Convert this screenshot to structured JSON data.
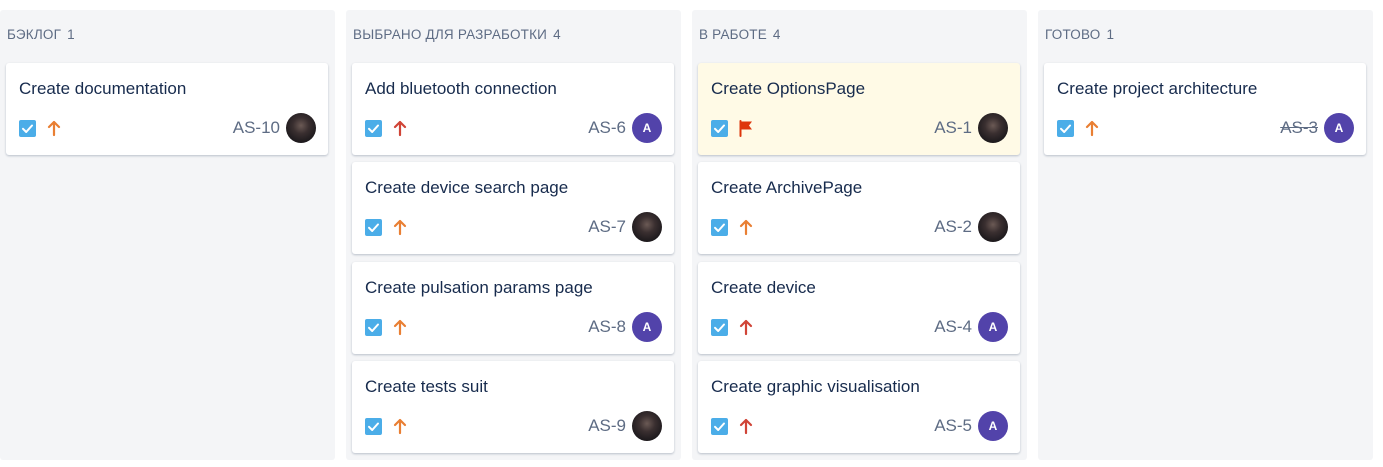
{
  "colors": {
    "column_bg": "#f4f5f7",
    "card_bg": "#ffffff",
    "flagged_bg": "#fffae6",
    "checkbox_blue": "#4bade8",
    "priority_high": "#e97f33",
    "priority_highest": "#d04437",
    "flag_red": "#de350b",
    "avatar_purple": "#5243aa",
    "text_primary": "#172b4d",
    "text_secondary": "#5e6c84"
  },
  "columns": [
    {
      "title": "БЭКЛОГ",
      "count": "1",
      "cards": [
        {
          "title": "Create documentation",
          "key": "AS-10",
          "type_icon": "checkbox-icon",
          "priority_icon": "arrow-up-icon",
          "avatar": "photo",
          "done": false,
          "flagged": false
        }
      ]
    },
    {
      "title": "ВЫБРАНО ДЛЯ РАЗРАБОТКИ",
      "count": "4",
      "cards": [
        {
          "title": "Add bluetooth connection",
          "key": "AS-6",
          "type_icon": "checkbox-icon",
          "priority_icon": "arrow-up-red-icon",
          "avatar": "A",
          "done": false,
          "flagged": false
        },
        {
          "title": "Create device search page",
          "key": "AS-7",
          "type_icon": "checkbox-icon",
          "priority_icon": "arrow-up-icon",
          "avatar": "photo",
          "done": false,
          "flagged": false
        },
        {
          "title": "Create pulsation params page",
          "key": "AS-8",
          "type_icon": "checkbox-icon",
          "priority_icon": "arrow-up-icon",
          "avatar": "A",
          "done": false,
          "flagged": false
        },
        {
          "title": "Create tests suit",
          "key": "AS-9",
          "type_icon": "checkbox-icon",
          "priority_icon": "arrow-up-icon",
          "avatar": "photo",
          "done": false,
          "flagged": false
        }
      ]
    },
    {
      "title": "В РАБОТЕ",
      "count": "4",
      "cards": [
        {
          "title": "Create OptionsPage",
          "key": "AS-1",
          "type_icon": "checkbox-icon",
          "priority_icon": "flag-icon",
          "avatar": "photo",
          "done": false,
          "flagged": true
        },
        {
          "title": "Create ArchivePage",
          "key": "AS-2",
          "type_icon": "checkbox-icon",
          "priority_icon": "arrow-up-icon",
          "avatar": "photo",
          "done": false,
          "flagged": false
        },
        {
          "title": "Create device",
          "key": "AS-4",
          "type_icon": "checkbox-icon",
          "priority_icon": "arrow-up-red-icon",
          "avatar": "A",
          "done": false,
          "flagged": false
        },
        {
          "title": "Create graphic visualisation",
          "key": "AS-5",
          "type_icon": "checkbox-icon",
          "priority_icon": "arrow-up-red-icon",
          "avatar": "A",
          "done": false,
          "flagged": false
        }
      ]
    },
    {
      "title": "ГОТОВО",
      "count": "1",
      "cards": [
        {
          "title": "Create project architecture",
          "key": "AS-3",
          "type_icon": "checkbox-icon",
          "priority_icon": "arrow-up-icon",
          "avatar": "A",
          "done": true,
          "flagged": false
        }
      ]
    }
  ]
}
